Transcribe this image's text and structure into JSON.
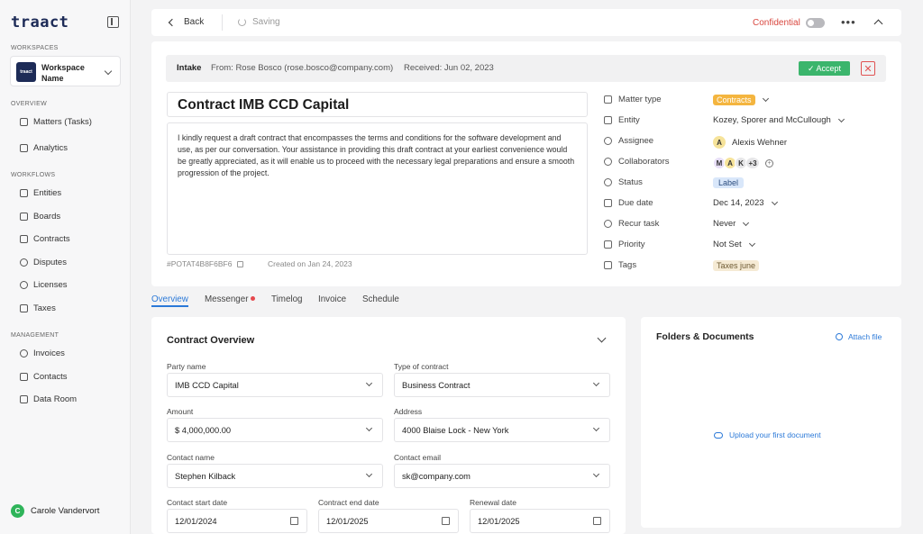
{
  "sidebar": {
    "logo": "traact",
    "workspaces_label": "WORKSPACES",
    "workspace": {
      "logo_text": "traact",
      "name": "Workspace Name"
    },
    "overview_label": "OVERVIEW",
    "overview_items": [
      {
        "label": "Matters (Tasks)",
        "icon": "list-icon"
      },
      {
        "label": "Analytics",
        "icon": "chart-icon"
      }
    ],
    "workflows_label": "WORKFLOWS",
    "workflow_items": [
      {
        "label": "Entities",
        "icon": "building-icon"
      },
      {
        "label": "Boards",
        "icon": "board-icon"
      },
      {
        "label": "Contracts",
        "icon": "contract-icon"
      },
      {
        "label": "Disputes",
        "icon": "gavel-icon"
      },
      {
        "label": "Licenses",
        "icon": "license-icon"
      },
      {
        "label": "Taxes",
        "icon": "receipt-icon"
      }
    ],
    "management_label": "MANAGEMENT",
    "management_items": [
      {
        "label": "Invoices",
        "icon": "dollar-icon"
      },
      {
        "label": "Contacts",
        "icon": "contacts-icon"
      },
      {
        "label": "Data Room",
        "icon": "database-icon"
      }
    ],
    "user": {
      "initial": "C",
      "name": "Carole Vandervort"
    }
  },
  "topbar": {
    "back_label": "Back",
    "saving_label": "Saving",
    "confidential_label": "Confidential",
    "more_label": "•••"
  },
  "intake": {
    "label": "Intake",
    "from": "From: Rose Bosco (rose.bosco@company.com)",
    "received": "Received: Jun 02, 2023",
    "accept_label": "✓ Accept",
    "reject_label": "✕"
  },
  "matter": {
    "title": "Contract IMB CCD Capital",
    "description": "I kindly request a draft contract that encompasses the terms and conditions for the software development and use, as per our conversation. Your assistance in providing this draft contract at your earliest convenience would be greatly appreciated, as it will enable us to proceed with the necessary legal preparations and ensure a smooth progression of the project.",
    "id": "#POTAT4B8F6BF6",
    "created": "Created on Jan 24, 2023"
  },
  "properties": {
    "matter_type": {
      "label": "Matter type",
      "value": "Contracts"
    },
    "entity": {
      "label": "Entity",
      "value": "Kozey, Sporer and McCullough"
    },
    "assignee": {
      "label": "Assignee",
      "initial": "A",
      "value": "Alexis Wehner"
    },
    "collaborators": {
      "label": "Collaborators",
      "avatars": [
        "M",
        "A",
        "K"
      ],
      "more": "+3"
    },
    "status": {
      "label": "Status",
      "value": "Label"
    },
    "due_date": {
      "label": "Due date",
      "value": "Dec 14, 2023"
    },
    "recur_task": {
      "label": "Recur task",
      "value": "Never"
    },
    "priority": {
      "label": "Priority",
      "value": "Not Set"
    },
    "tags": {
      "label": "Tags",
      "value": "Taxes june"
    }
  },
  "tabs": [
    "Overview",
    "Messenger",
    "Timelog",
    "Invoice",
    "Schedule"
  ],
  "overview": {
    "title": "Contract Overview",
    "party_name": {
      "label": "Party name",
      "value": "IMB CCD Capital"
    },
    "contract_type": {
      "label": "Type of contract",
      "value": "Business Contract"
    },
    "amount": {
      "label": "Amount",
      "value": "$ 4,000,000.00"
    },
    "address": {
      "label": "Address",
      "value": "4000 Blaise Lock - New York"
    },
    "contact_name": {
      "label": "Contact name",
      "value": "Stephen Kilback"
    },
    "contact_email": {
      "label": "Contact email",
      "value": "sk@company.com"
    },
    "start_date": {
      "label": "Contact start date",
      "value": "12/01/2024"
    },
    "end_date": {
      "label": "Contract end date",
      "value": "12/01/2025"
    },
    "renewal_date": {
      "label": "Renewal date",
      "value": "12/01/2025"
    }
  },
  "folders": {
    "title": "Folders & Documents",
    "attach_label": "Attach file",
    "upload_label": "Upload your first document"
  },
  "colors": {
    "accent": "#2b79d8",
    "accept": "#3bb56c",
    "danger": "#e05252",
    "brand": "#1d2b57"
  }
}
